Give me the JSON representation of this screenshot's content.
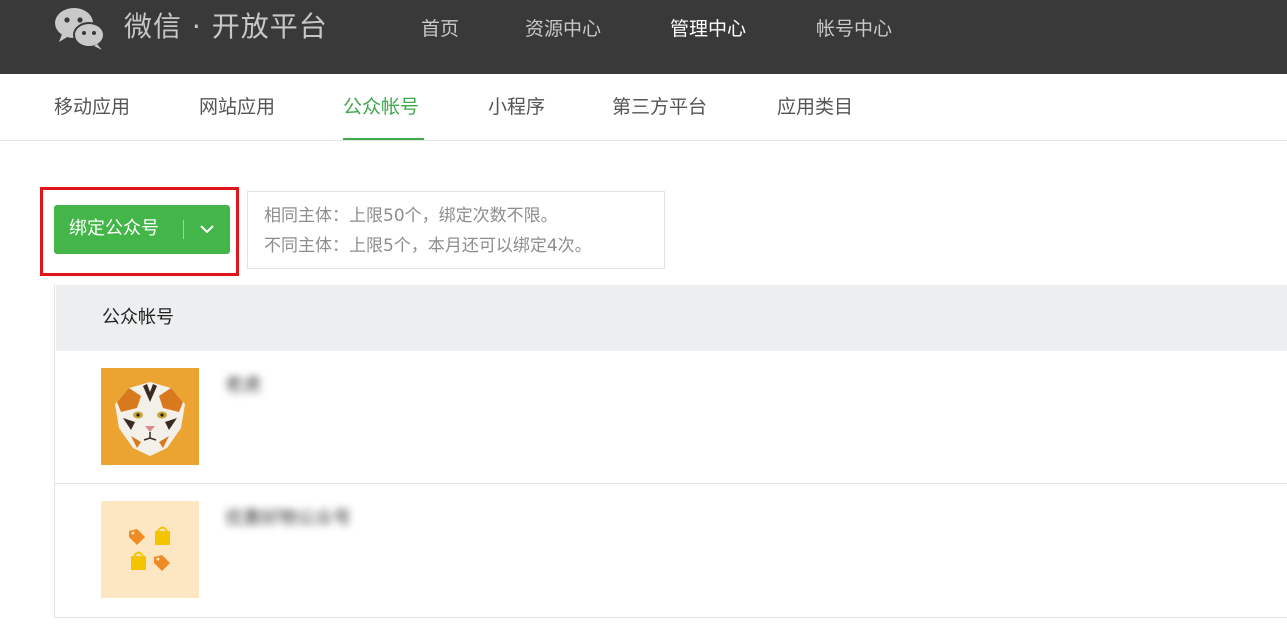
{
  "brand": {
    "title": "微信 · 开放平台",
    "logo_icon": "wechat-logo-icon"
  },
  "top_nav": [
    {
      "label": "首页",
      "active": false
    },
    {
      "label": "资源中心",
      "active": false
    },
    {
      "label": "管理中心",
      "active": true
    },
    {
      "label": "帐号中心",
      "active": false
    }
  ],
  "sub_nav": [
    {
      "label": "移动应用",
      "active": false
    },
    {
      "label": "网站应用",
      "active": false
    },
    {
      "label": "公众帐号",
      "active": true
    },
    {
      "label": "小程序",
      "active": false
    },
    {
      "label": "第三方平台",
      "active": false
    },
    {
      "label": "应用类目",
      "active": false
    }
  ],
  "bind_button": {
    "label": "绑定公众号",
    "dropdown_icon": "chevron-down-icon"
  },
  "limit_note": {
    "line1": "相同主体：上限50个，绑定次数不限。",
    "line2": "不同主体：上限5个，本月还可以绑定4次。"
  },
  "table": {
    "header": "公众帐号",
    "rows": [
      {
        "name": "老虎",
        "avatar_icon": "tiger-avatar-icon"
      },
      {
        "name": "优惠好物公众号",
        "avatar_icon": "shopping-tags-avatar-icon"
      }
    ]
  },
  "colors": {
    "topbar": "#393939",
    "accent_green": "#44b549",
    "active_tab": "#3ea84d",
    "highlight_red": "#e3131a",
    "table_header_bg": "#eceeef"
  }
}
